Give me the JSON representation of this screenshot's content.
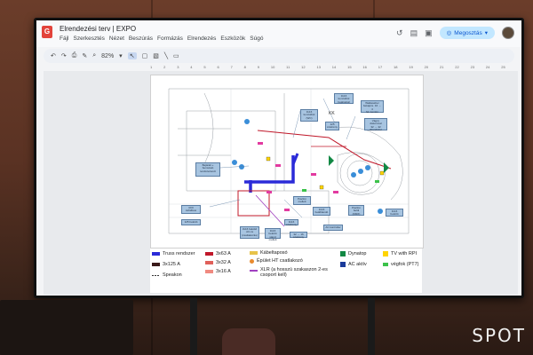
{
  "app": {
    "logo_glyph": "G",
    "title": "Elrendezési terv | EXPO",
    "menu": [
      "Fájl",
      "Szerkesztés",
      "Nézet",
      "Beszúrás",
      "Formázás",
      "Elrendezés",
      "Eszközök",
      "Súgó"
    ],
    "share_label": "Megosztás",
    "zoom": "82%"
  },
  "ruler_numbers": [
    "1",
    "2",
    "3",
    "4",
    "5",
    "6",
    "7",
    "8",
    "9",
    "10",
    "11",
    "12",
    "13",
    "14",
    "15",
    "16",
    "17",
    "18",
    "19",
    "20",
    "21",
    "22",
    "23",
    "24",
    "25"
  ],
  "callouts": [
    "3x16\nkonzolból\nbejáratnál",
    "Wallwasher\nbekapcs. 16 → 4\nfal mentén",
    "3x16\nkonzolból\n(WC)",
    "125\nszekrény",
    "Vágni, dátummal\n32 → 42\nalrendszer",
    "Bejárati +\nbemutató\nrendszerteszt",
    "3XX\ntorfallrew",
    "125 bekötő",
    "Pavilon\nmellett",
    "3x16\nbeállítandó",
    "Pavilon\nbelül\n(DMX)",
    "3x16\nbekötő",
    "AC kontroller",
    "3x16 bekötő\nAC-ra\n(csatlakozás)",
    "3x16 bekötő\nstand\nmellett",
    "3x16\nszekrény",
    "32 → 16\nszekrény"
  ],
  "legend": {
    "truss": "Truss rendszer",
    "c3x125": "3x125 A",
    "speakon": "Speakon",
    "c3x63": "3x63 A",
    "c3x32": "3x32 A",
    "c3x16": "3x16 A",
    "kabel": "Kábeltaposó",
    "epulet": "Épület HT csatlakozó",
    "xlr": "XLR (a hosszú szakaszon 2-es csoport kell)",
    "dynatop": "Dynatop",
    "ac": "AC aktív",
    "tv": "TV with RPI",
    "vegfok": "végfok (PT7)"
  },
  "colors": {
    "truss": "#2b2bd8",
    "c3x125": "#3a1a1a",
    "c3x63": "#c0182a",
    "c3x32": "#e0605a",
    "c3x16": "#f08a80",
    "kabel": "#e7c34a",
    "epulet": "#e98a2e",
    "xlr": "#a040c0",
    "dynatop": "#118844",
    "ac": "#1a3a9a",
    "tv": "#ffd400",
    "vegfok": "#3cc24a",
    "callout": "#a7c4e0"
  },
  "watermark": "SPOT"
}
